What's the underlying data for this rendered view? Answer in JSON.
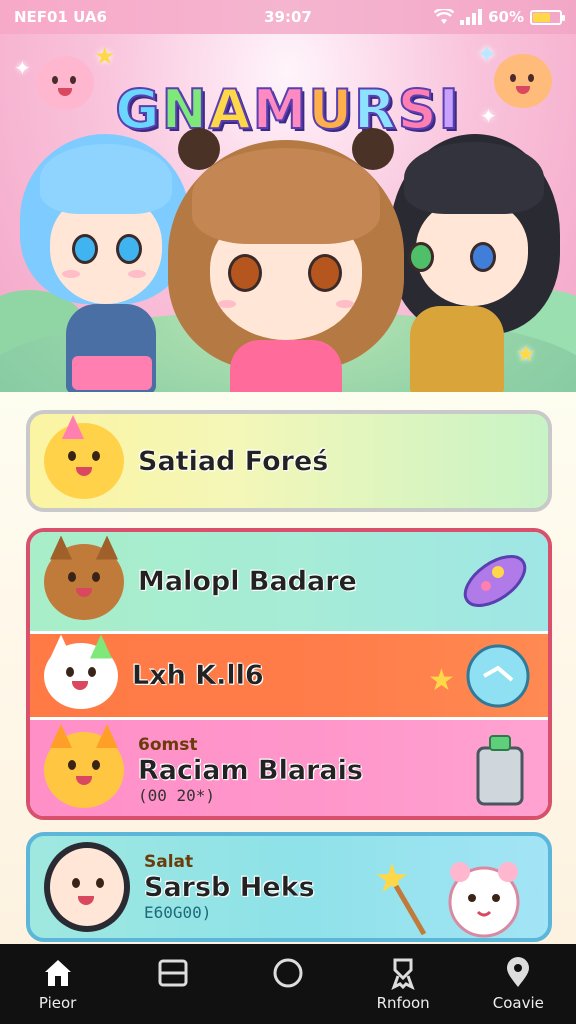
{
  "status_bar": {
    "carrier": "NEF01 UA6",
    "time": "39:07",
    "battery": "60%",
    "battery_level": 0.6
  },
  "hero": {
    "title": "GNAMURSI",
    "title_letters": [
      "G",
      "N",
      "A",
      "M",
      "U",
      "R",
      "S",
      "I"
    ]
  },
  "menu": [
    {
      "label": "Satiad Forеś",
      "caption": "",
      "sub": ""
    },
    {
      "label": "Malopl Badare",
      "caption": "",
      "sub": ""
    },
    {
      "label": "Lxh K.ll6",
      "caption": "",
      "sub": ""
    },
    {
      "label": "Raciam Blarais",
      "caption": "6omst",
      "sub": "(00 20*)"
    },
    {
      "label": "Sarsb Heks",
      "caption": "Salat",
      "sub": "E60G00)"
    }
  ],
  "nav": [
    {
      "label": "Pieor",
      "icon": "home-icon"
    },
    {
      "label": "",
      "icon": "window-icon"
    },
    {
      "label": "",
      "icon": "circle-icon"
    },
    {
      "label": "Rnfoon",
      "icon": "ribbon-icon"
    },
    {
      "label": "Coavie",
      "icon": "location-pin-icon"
    }
  ],
  "colors": {
    "hero_pink": "#f4a3c6",
    "card1": "#f7f3a8",
    "card2": "#a6ecd6",
    "card3": "#ff7a45",
    "card4": "#ff8fc7",
    "card5": "#8ee2e8",
    "nav_bg": "#111111"
  }
}
